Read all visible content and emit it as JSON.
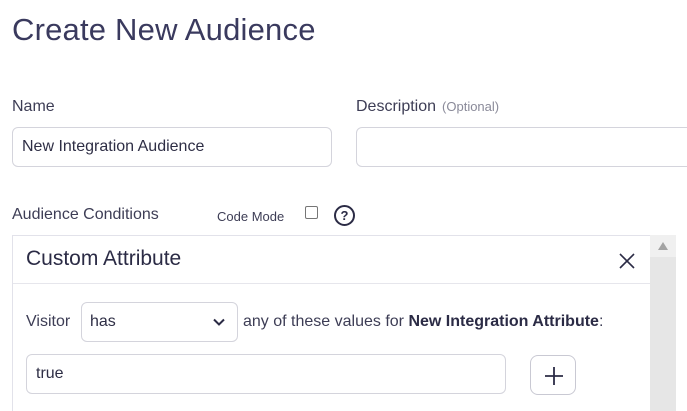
{
  "page": {
    "title": "Create New Audience"
  },
  "form": {
    "name_label": "Name",
    "name_value": "New Integration Audience",
    "description_label": "Description",
    "description_optional": "(Optional)",
    "description_value": ""
  },
  "conditions": {
    "label": "Audience Conditions",
    "code_mode_label": "Code Mode",
    "code_mode_checked": false,
    "help_icon_text": "?",
    "card": {
      "title": "Custom Attribute",
      "visitor_label": "Visitor",
      "match_select_value": "has",
      "condition_text": "any of these values for",
      "attribute_name": "New Integration Attribute",
      "attribute_suffix": ":",
      "value": "true"
    }
  },
  "icons": {
    "close": "close-icon",
    "chevron": "chevron-down-icon",
    "add": "plus-icon",
    "help": "question-circle-icon",
    "scroll_up": "scroll-up-arrow-icon"
  }
}
